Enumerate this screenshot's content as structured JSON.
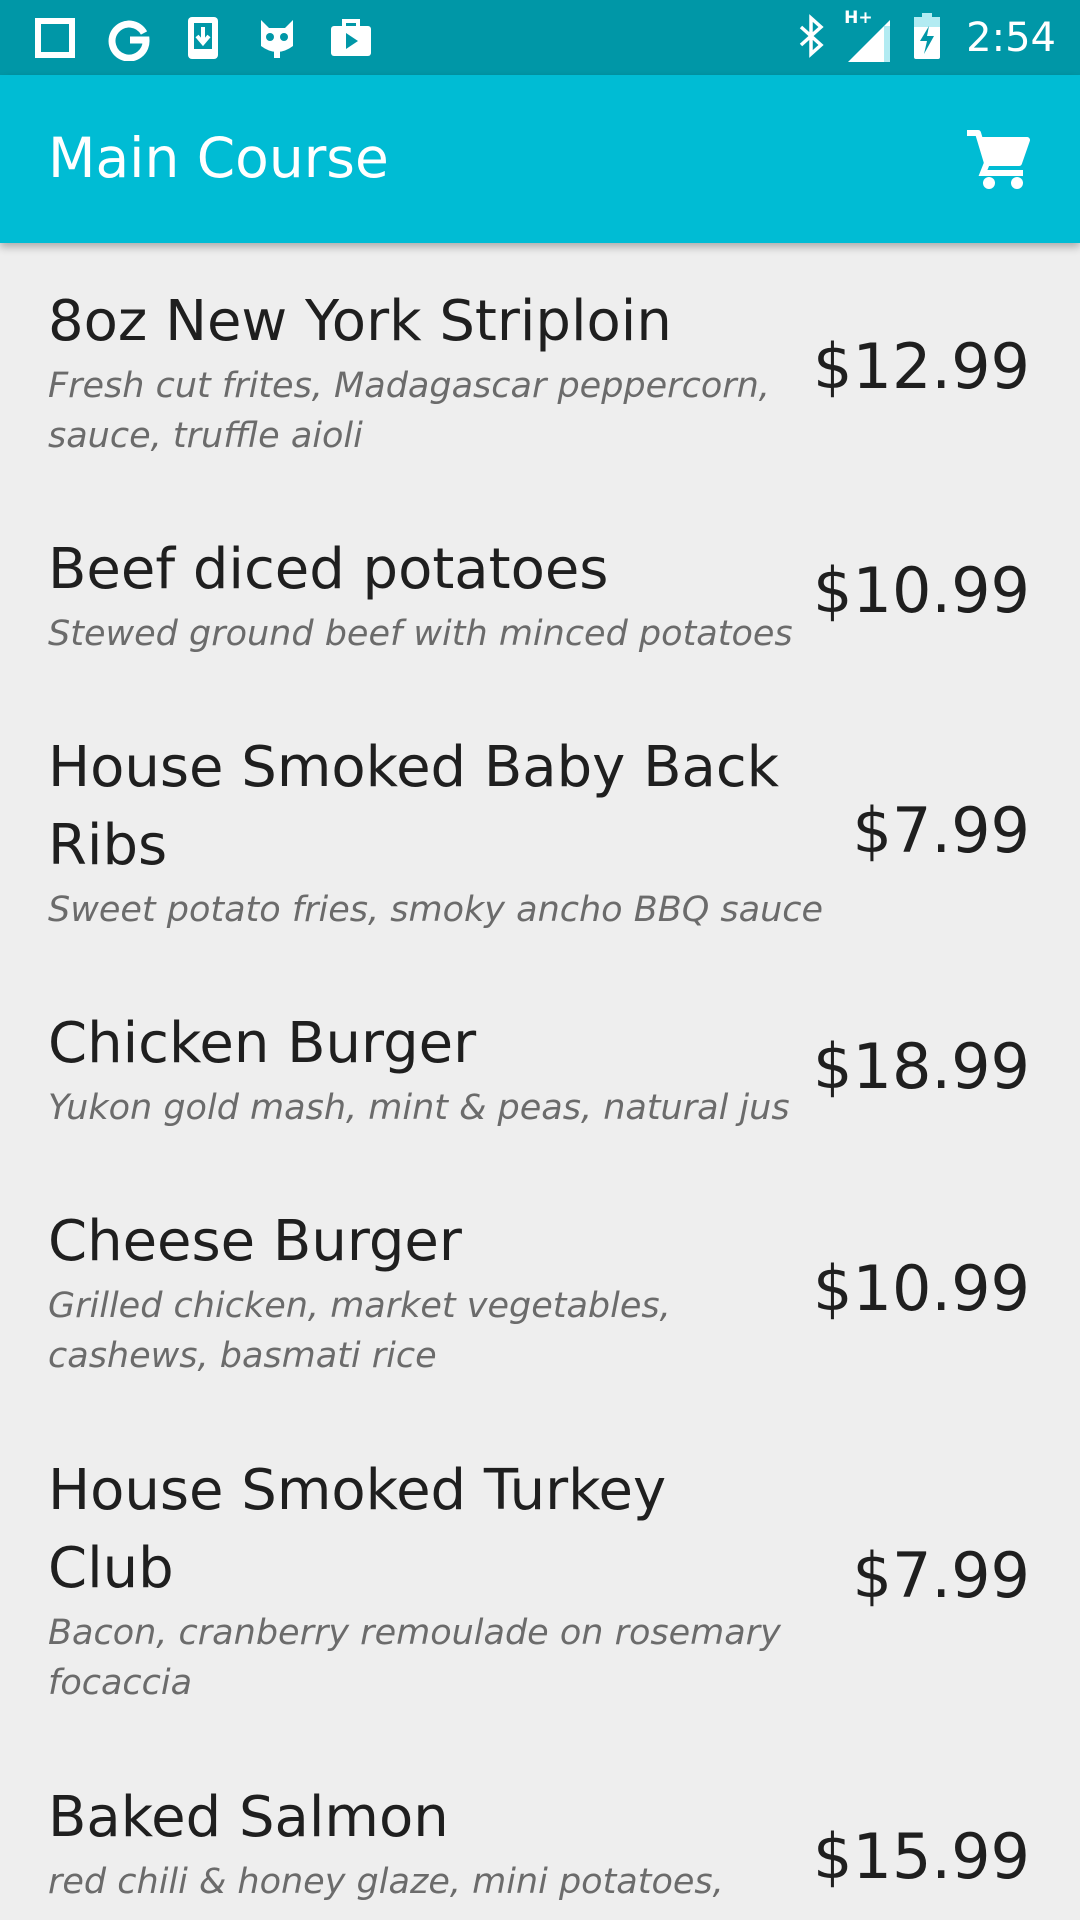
{
  "status_bar": {
    "time": "2:54",
    "network_label": "H+",
    "left_icons": [
      "square-icon",
      "google-icon",
      "download-icon",
      "cyanogen-icon",
      "store-icon"
    ],
    "right_icons": [
      "bluetooth-icon",
      "signal-icon",
      "battery-charging-icon"
    ]
  },
  "app_bar": {
    "title": "Main Course",
    "cart_icon": "cart-icon"
  },
  "menu": {
    "items": [
      {
        "name_lines": [
          "8oz New York Striploin"
        ],
        "desc_lines": [
          "Fresh cut frites, Madagascar peppercorn,",
          "sauce, truffle aioli"
        ],
        "price": "$12.99"
      },
      {
        "name_lines": [
          "Beef diced potatoes"
        ],
        "desc_lines": [
          "Stewed ground beef with minced potatoes"
        ],
        "price": "$10.99"
      },
      {
        "name_lines": [
          "House Smoked Baby Back",
          "Ribs"
        ],
        "desc_lines": [
          "Sweet potato fries, smoky ancho BBQ sauce"
        ],
        "price": "$7.99"
      },
      {
        "name_lines": [
          "Chicken Burger"
        ],
        "desc_lines": [
          "Yukon gold mash, mint & peas, natural jus"
        ],
        "price": "$18.99"
      },
      {
        "name_lines": [
          "Cheese Burger"
        ],
        "desc_lines": [
          "Grilled chicken, market vegetables,",
          "cashews, basmati rice"
        ],
        "price": "$10.99"
      },
      {
        "name_lines": [
          "House Smoked Turkey",
          "Club"
        ],
        "desc_lines": [
          "Bacon, cranberry remoulade on rosemary",
          "focaccia"
        ],
        "price": "$7.99"
      },
      {
        "name_lines": [
          "Baked Salmon"
        ],
        "desc_lines": [
          "red chili & honey glaze, mini potatoes,"
        ],
        "price": "$15.99"
      }
    ]
  },
  "colors": {
    "status_bar": "#0097a7",
    "app_bar": "#00bcd4",
    "background": "#eeeeee",
    "text_primary": "#1f1f1f",
    "text_secondary": "#6b6b6b"
  }
}
